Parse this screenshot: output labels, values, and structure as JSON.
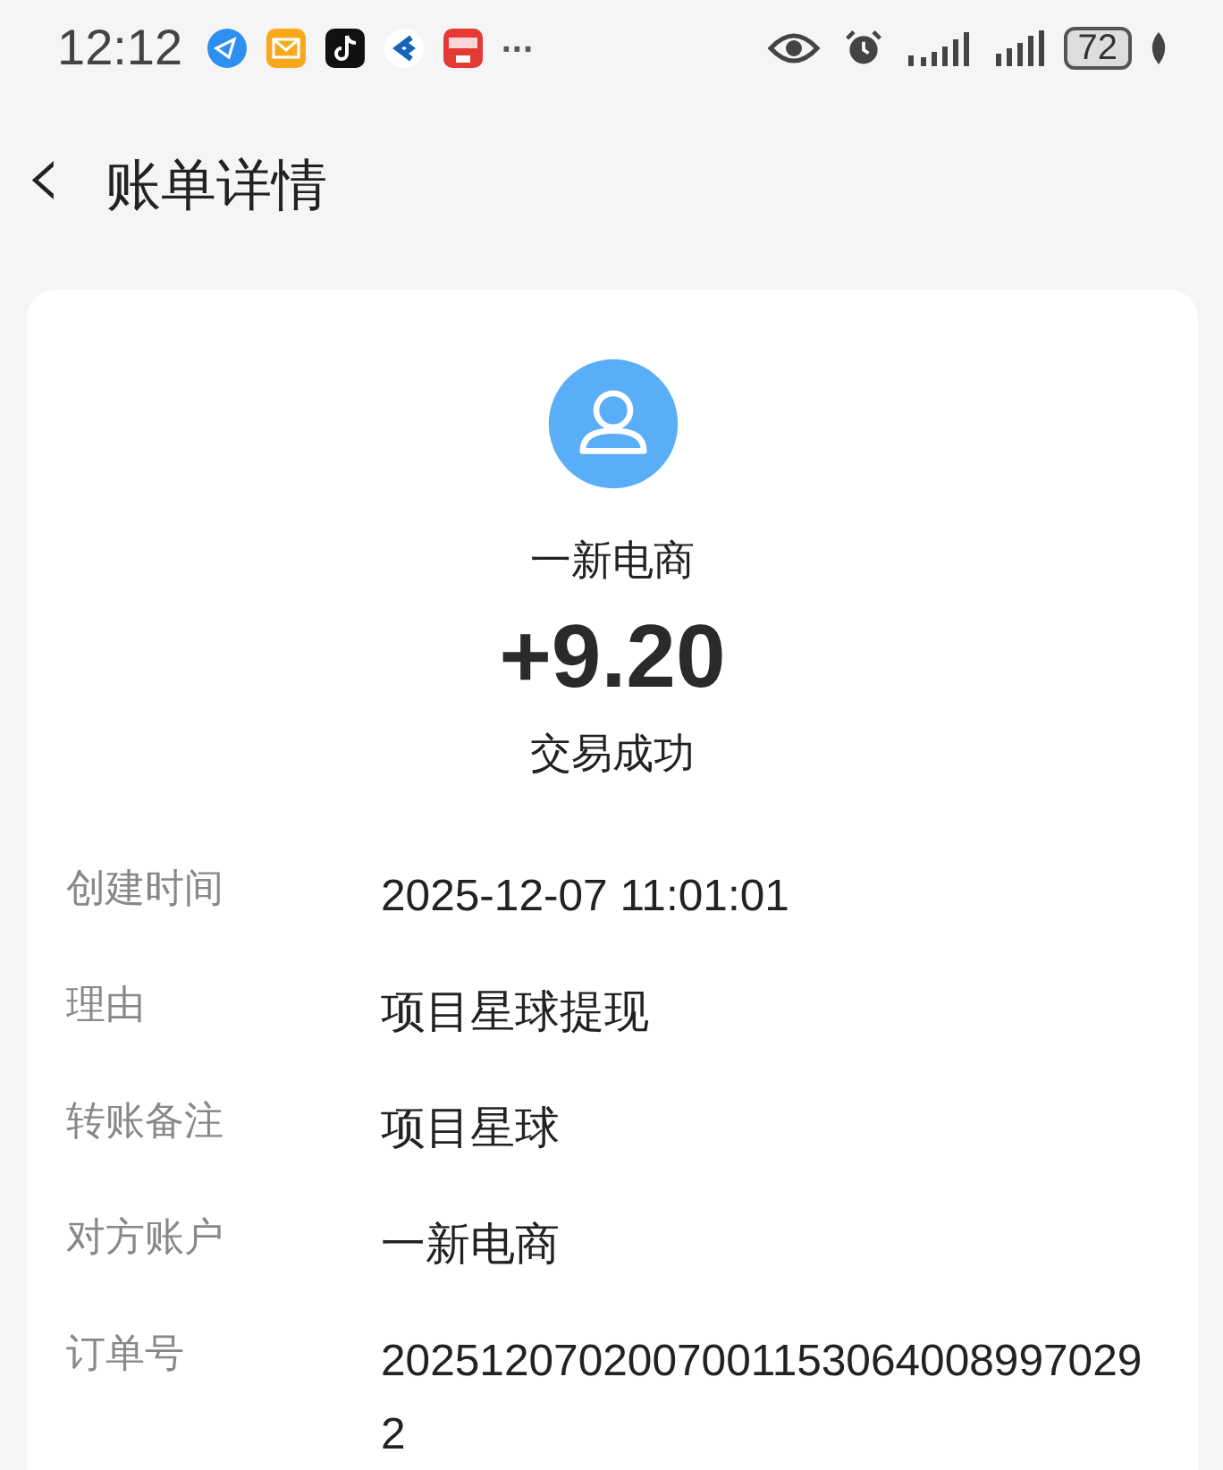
{
  "status_bar": {
    "time": "12:12",
    "overflow": "···",
    "battery": "72"
  },
  "header": {
    "back": "‹",
    "title": "账单详情"
  },
  "summary": {
    "name": "一新电商",
    "amount": "+9.20",
    "status": "交易成功"
  },
  "details": [
    {
      "label": "创建时间",
      "value": "2025-12-07 11:01:01"
    },
    {
      "label": "理由",
      "value": "项目星球提现"
    },
    {
      "label": "转账备注",
      "value": "项目星球"
    },
    {
      "label": "对方账户",
      "value": "一新电商"
    },
    {
      "label": "订单号",
      "value": "20251207020070011530640089970292"
    }
  ]
}
